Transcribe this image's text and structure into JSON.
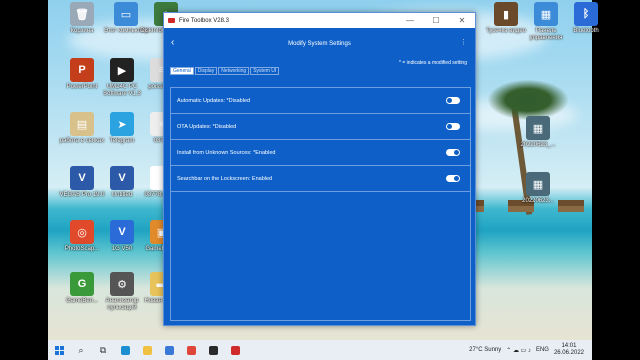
{
  "desktop": {
    "icons": [
      {
        "label": "Корзина",
        "color": "#9aa9b8",
        "glyph": "🗑"
      },
      {
        "label": "Этот компьютер",
        "color": "#3b8bd8",
        "glyph": "▭"
      },
      {
        "label": "DiskInfo64 - Ярлык",
        "color": "#3d7a3d",
        "glyph": "●"
      },
      {
        "label": "PowerPoint",
        "color": "#c43e1c",
        "glyph": "P"
      },
      {
        "label": "UM24C PC Software V1.3",
        "color": "#222222",
        "glyph": "▶"
      },
      {
        "label": "poissibility",
        "color": "#dddddd",
        "glyph": "≡"
      },
      {
        "label": "работа в свиках",
        "color": "#d8c18a",
        "glyph": "▤"
      },
      {
        "label": "Telegram",
        "color": "#2aa3e0",
        "glyph": "➤"
      },
      {
        "label": "03778",
        "color": "#eeeeee",
        "glyph": "●"
      },
      {
        "label": "VEGAS Pro 19.0",
        "color": "#2c59a8",
        "glyph": "V"
      },
      {
        "label": "Untitled",
        "color": "#2c59a8",
        "glyph": "V"
      },
      {
        "label": "03778.mp3...",
        "color": "#ffffff",
        "glyph": "♪"
      },
      {
        "label": "PhotoScap...",
        "color": "#e04a2a",
        "glyph": "◎"
      },
      {
        "label": "1G V50",
        "color": "#2a6bd8",
        "glyph": "V"
      },
      {
        "label": "GameBench",
        "color": "#e08a2a",
        "glyph": "▣"
      },
      {
        "label": "GameBen...",
        "color": "#3a9a3a",
        "glyph": "G"
      },
      {
        "label": "Анализатор пульсаций",
        "color": "#555555",
        "glyph": "⚙"
      },
      {
        "label": "Новая папка",
        "color": "#e8c25a",
        "glyph": "▬"
      },
      {
        "label": "Тусечка видео",
        "color": "#6a4a2a",
        "glyph": "▮"
      },
      {
        "label": "Панель управления",
        "color": "#3b8bd8",
        "glyph": "▦"
      },
      {
        "label": "Bluetooth",
        "color": "#2a6bd8",
        "glyph": "ᛒ"
      },
      {
        "label": "20220623_...",
        "color": "#4a6a7a",
        "glyph": "▦"
      },
      {
        "label": "20220623...",
        "color": "#4a6a7a",
        "glyph": "▦"
      }
    ]
  },
  "window": {
    "title": "Fire Toolbox V28.3",
    "minimize": "—",
    "maximize": "☐",
    "close": "✕",
    "back_glyph": "‹",
    "page_title": "Modify System Settings",
    "more_glyph": "⋮",
    "modified_note": "* = indicates a modified setting",
    "tabs": [
      "General",
      "Display",
      "Networking",
      "System UI"
    ],
    "active_tab": "General",
    "settings": [
      {
        "label": "Automatic Updates: *Disabled",
        "enabled": false
      },
      {
        "label": "OTA Updates: *Disabled",
        "enabled": false
      },
      {
        "label": "Install from Unknown Sources: *Enabled",
        "enabled": true
      },
      {
        "label": "Searchbar on the Lockscreen: Enabled",
        "enabled": true
      }
    ]
  },
  "taskbar": {
    "search_glyph": "⌕",
    "taskview_glyph": "⧉",
    "apps": [
      {
        "name": "edge",
        "color": "#1c8fd1"
      },
      {
        "name": "files",
        "color": "#f0c040"
      },
      {
        "name": "store",
        "color": "#3a78d8"
      },
      {
        "name": "chrome",
        "color": "#e0453a"
      },
      {
        "name": "monitor",
        "color": "#2a2a2a"
      },
      {
        "name": "fire-toolbox",
        "color": "#d12a2a"
      }
    ],
    "weather": "27°C  Sunny",
    "tray_glyphs": "⌃ ☁ ▭ ♪",
    "language": "ENG",
    "time": "14:01",
    "date": "26.06.2022"
  }
}
